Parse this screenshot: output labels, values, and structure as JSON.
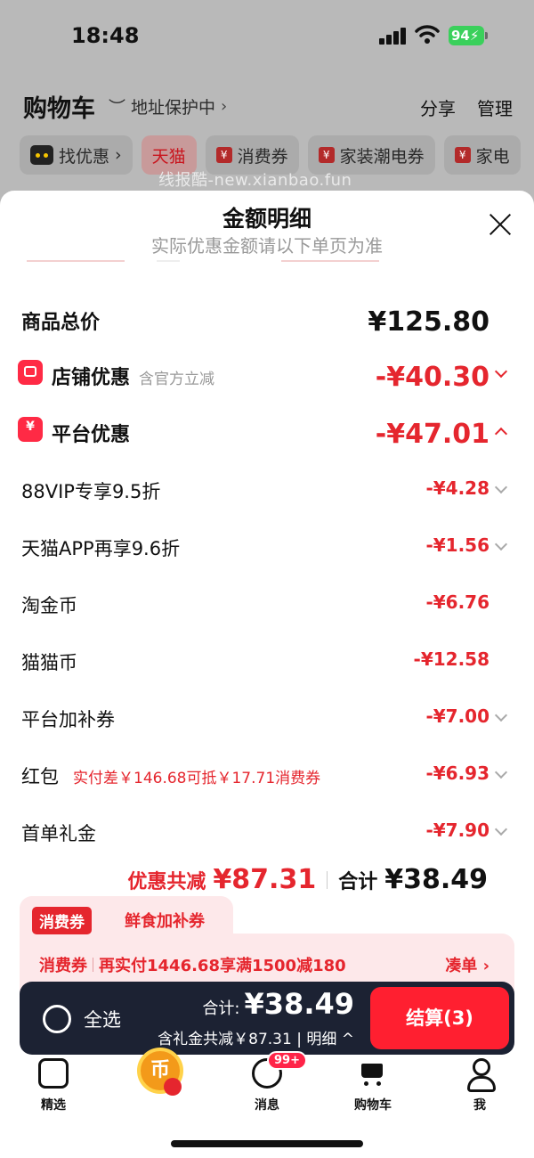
{
  "status_bar": {
    "time": "18:48",
    "battery": "94"
  },
  "header": {
    "title": "购物车",
    "address_status": "地址保护中",
    "share": "分享",
    "manage": "管理"
  },
  "chips": [
    {
      "label": "找优惠",
      "icon": "tmall-cat-icon"
    },
    {
      "label": "天猫",
      "active": true
    },
    {
      "label": "消费券",
      "icon": "coupon-icon"
    },
    {
      "label": "家装潮电券",
      "icon": "coupon-icon"
    },
    {
      "label": "家电",
      "icon": "coupon-icon"
    }
  ],
  "watermark": "线报酷-new.xianbao.fun",
  "sheet": {
    "title": "金额明细",
    "subtitle": "实际优惠金额请以下单页为准",
    "rows": {
      "total_price": {
        "label": "商品总价",
        "amount": "¥125.80"
      },
      "store_discount": {
        "label": "店铺优惠",
        "note": "含官方立减",
        "amount": "-¥40.30"
      },
      "platform_discount": {
        "label": "平台优惠",
        "amount": "-¥47.01"
      },
      "vip": {
        "label": "88VIP专享9.5折",
        "amount": "-¥4.28"
      },
      "app": {
        "label": "天猫APP再享9.6折",
        "amount": "-¥1.56"
      },
      "taojinbi": {
        "label": "淘金币",
        "amount": "-¥6.76"
      },
      "maomaobi": {
        "label": "猫猫币",
        "amount": "-¥12.58"
      },
      "platform_coupon": {
        "label": "平台加补券",
        "amount": "-¥7.00"
      },
      "red_packet": {
        "label": "红包",
        "note": "实付差￥146.68可抵￥17.71消费券",
        "amount": "-¥6.93"
      },
      "first_order": {
        "label": "首单礼金",
        "amount": "-¥7.90"
      }
    },
    "summary": {
      "saved_label": "优惠共减",
      "saved_value": "¥87.31",
      "total_label": "合计",
      "total_value": "¥38.49"
    }
  },
  "coupon": {
    "badge": "消费券",
    "name": "鲜食加补券",
    "line_badge": "消费券",
    "line_text": "再实付1446.68享满1500减180",
    "action": "凑单 ›"
  },
  "checkout": {
    "select_all": "全选",
    "total_label": "合计:",
    "total_value": "¥38.49",
    "detail": "含礼金共减￥87.31 | 明细 ^",
    "pay": "结算(3)"
  },
  "tabbar": {
    "home": "精选",
    "coin": "币",
    "messages": "消息",
    "messages_badge": "99+",
    "cart": "购物车",
    "me": "我"
  },
  "colors": {
    "accent": "#e5262e",
    "checkout_bg": "#1c2233",
    "pay_button": "#ff1f30"
  }
}
